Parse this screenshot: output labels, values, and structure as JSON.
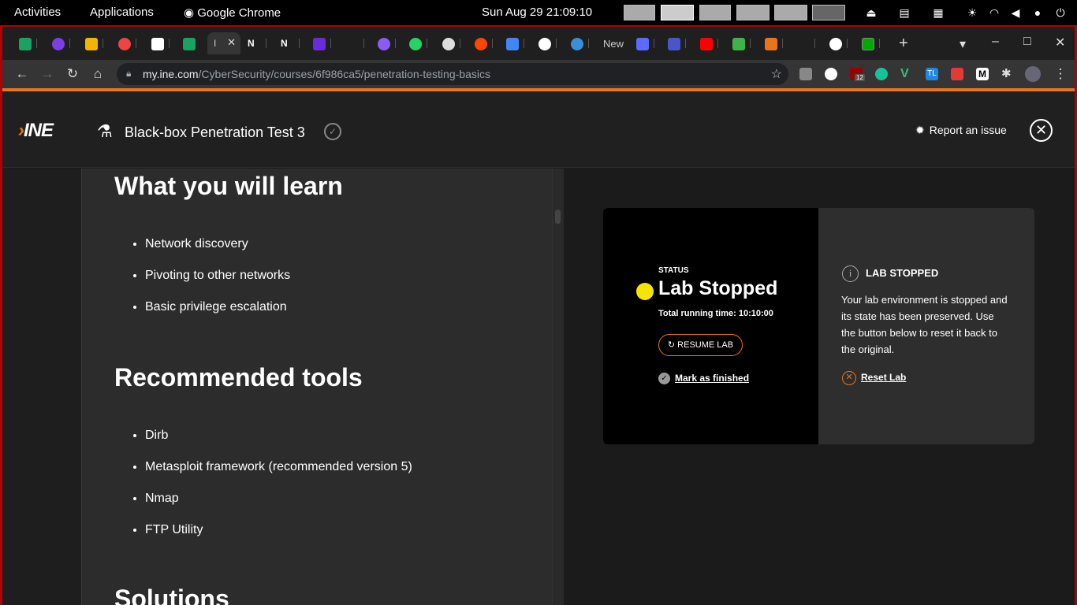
{
  "os_bar": {
    "activities": "Activities",
    "applications": "Applications",
    "app_name": "Google Chrome",
    "clock": "Sun Aug 29  21:09:10"
  },
  "browser": {
    "active_tab_label": "I",
    "tab_labels": [
      "N",
      "N",
      "New"
    ],
    "url_host": "my.ine.com",
    "url_path": "/CyberSecurity/courses/6f986ca5/penetration-testing-basics",
    "ext_badge": "12",
    "ext_tl": "TL",
    "ext_m": "M"
  },
  "header": {
    "logo": "INE",
    "lab_title": "Black-box Penetration Test 3",
    "report_label": "Report an issue"
  },
  "article": {
    "learn_heading": "What you will learn",
    "learn_items": [
      "Network discovery",
      "Pivoting to other networks",
      "Basic privilege escalation"
    ],
    "tools_heading": "Recommended tools",
    "tools_items": [
      "Dirb",
      "Metasploit framework (recommended version 5)",
      "Nmap",
      "FTP Utility"
    ],
    "solutions_heading": "Solutions"
  },
  "lab": {
    "status_label": "STATUS",
    "state": "Lab Stopped",
    "running_time": "Total running time: 10:10:00",
    "resume_label": "RESUME LAB",
    "finish_label": "Mark as finished",
    "info_title": "LAB STOPPED",
    "info_text": "Your lab environment is stopped and its state has been preserved. Use the button below to reset it back to the original.",
    "reset_label": "Reset Lab"
  },
  "colors": {
    "accent": "#e8741c",
    "status_dot": "#f5e400",
    "frame_border": "#b30000"
  }
}
